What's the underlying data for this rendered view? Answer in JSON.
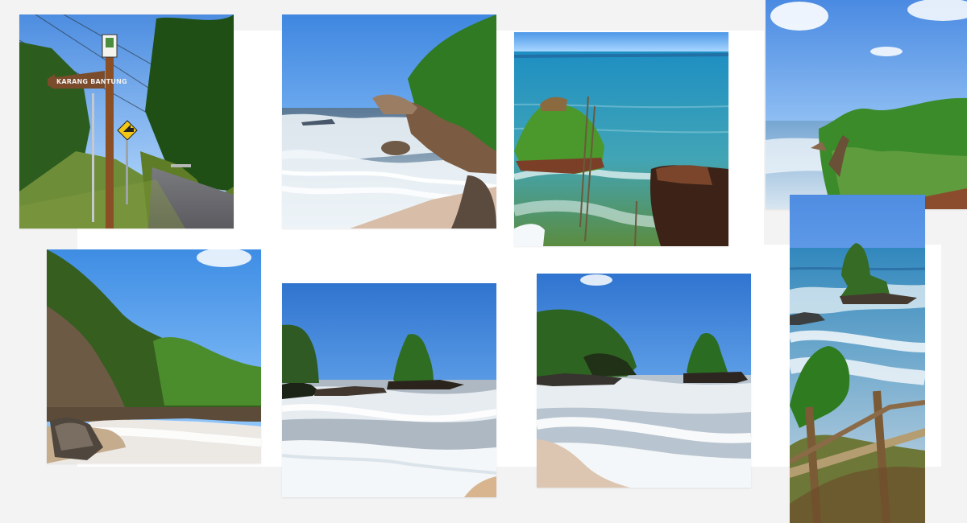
{
  "gallery": {
    "photos": [
      {
        "id": "photo-1",
        "alt": "",
        "sign_text": "KARANG BANTUNG"
      },
      {
        "id": "photo-2",
        "alt": ""
      },
      {
        "id": "photo-3",
        "alt": ""
      },
      {
        "id": "photo-4",
        "alt": ""
      },
      {
        "id": "photo-5",
        "alt": ""
      },
      {
        "id": "photo-6",
        "alt": ""
      },
      {
        "id": "photo-7",
        "alt": ""
      },
      {
        "id": "photo-8",
        "alt": ""
      }
    ]
  },
  "colors": {
    "background": "#f3f3f4",
    "panel": "#ffffff",
    "sky": "#4f8fe1",
    "sea": "#2f8fba",
    "foam": "#f2f5f7",
    "sand": "#d5b8a1",
    "vegetation": "#3d7f2a",
    "rock": "#5a4433"
  }
}
